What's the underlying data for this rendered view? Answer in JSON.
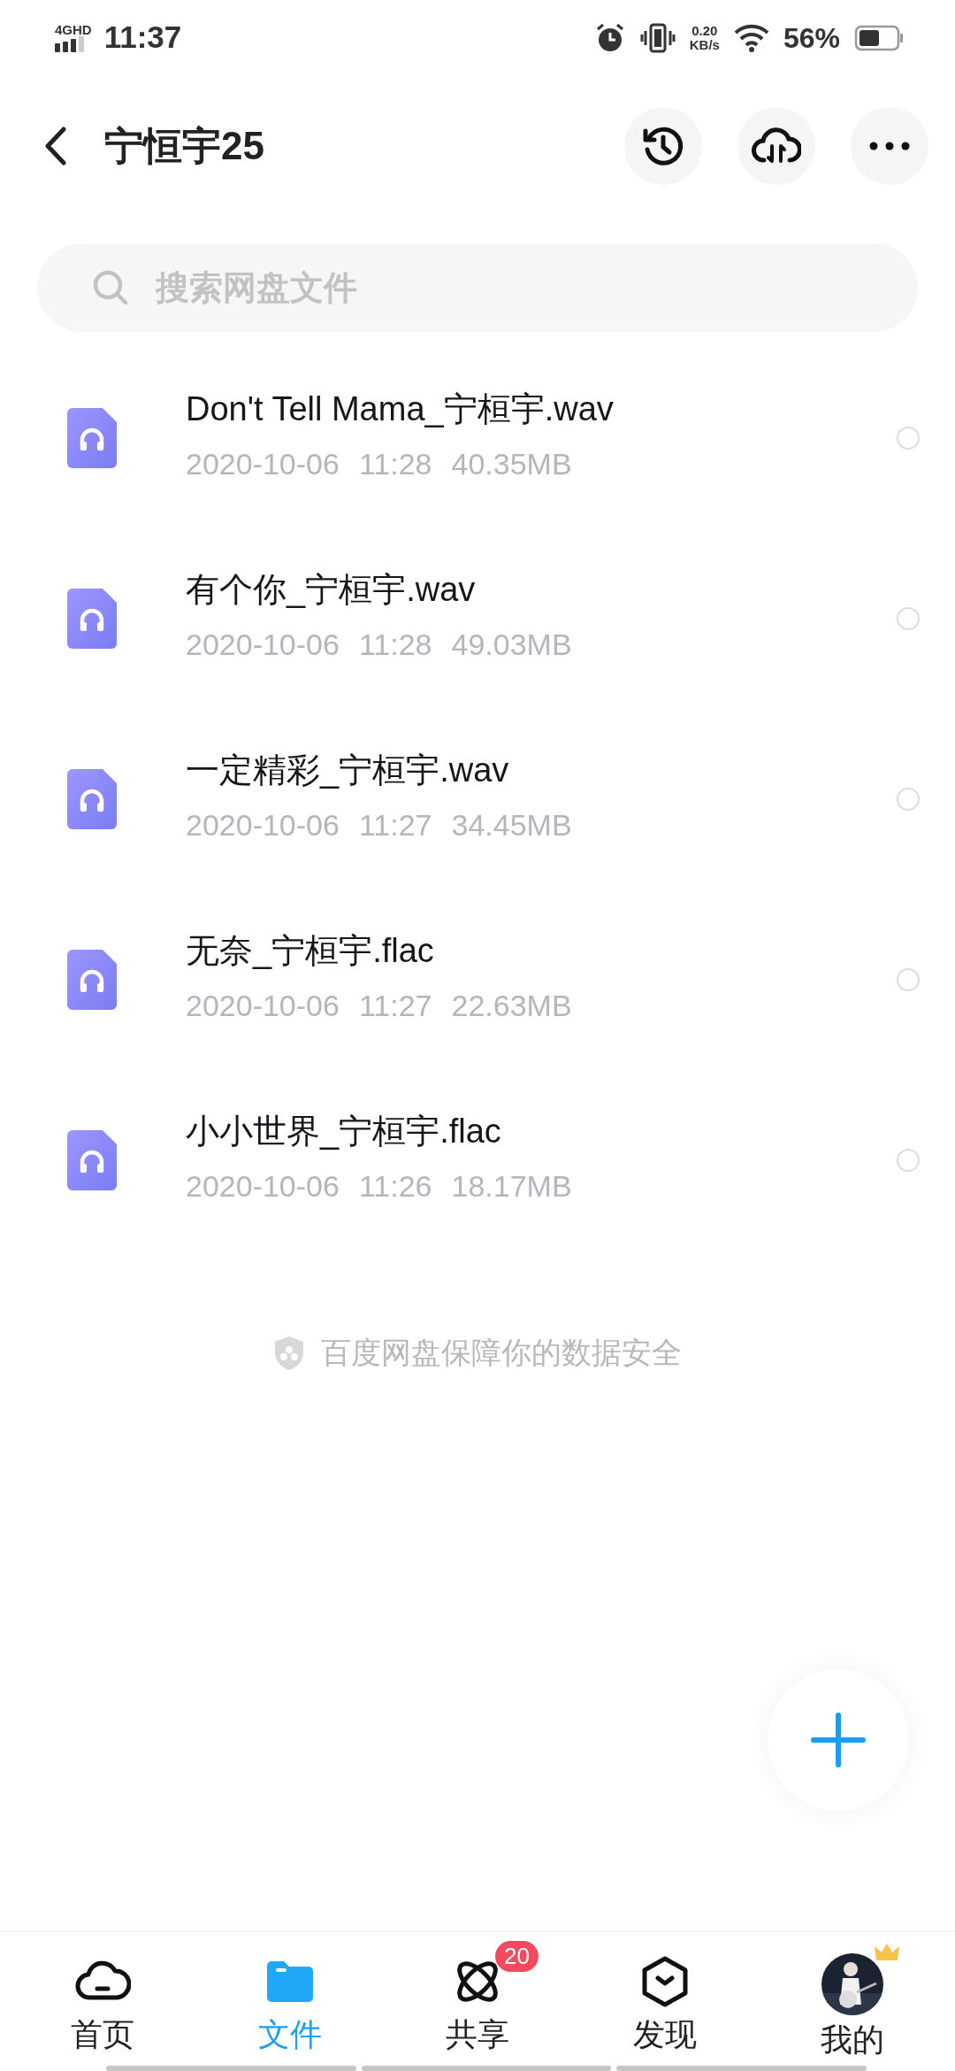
{
  "status_bar": {
    "network": "4G",
    "network_hd": "HD",
    "time": "11:37",
    "speed": "0.20",
    "speed_unit": "KB/s",
    "battery": "56%"
  },
  "header": {
    "title": "宁恒宇25"
  },
  "search": {
    "placeholder": "搜索网盘文件"
  },
  "files": [
    {
      "name": "Don't Tell Mama_宁桓宇.wav",
      "date": "2020-10-06",
      "time": "11:28",
      "size": "40.35MB",
      "selected": false
    },
    {
      "name": "有个你_宁桓宇.wav",
      "date": "2020-10-06",
      "time": "11:28",
      "size": "49.03MB",
      "selected": false
    },
    {
      "name": "一定精彩_宁桓宇.wav",
      "date": "2020-10-06",
      "time": "11:27",
      "size": "34.45MB",
      "selected": false
    },
    {
      "name": "无奈_宁桓宇.flac",
      "date": "2020-10-06",
      "time": "11:27",
      "size": "22.63MB",
      "selected": false
    },
    {
      "name": "小小世界_宁桓宇.flac",
      "date": "2020-10-06",
      "time": "11:26",
      "size": "18.17MB",
      "selected": false
    }
  ],
  "footer_note": "百度网盘保障你的数据安全",
  "tabs": [
    {
      "kind": "home",
      "label": "首页",
      "selected": false
    },
    {
      "kind": "files",
      "label": "文件",
      "selected": true
    },
    {
      "kind": "share",
      "label": "共享",
      "selected": false,
      "badge": "20"
    },
    {
      "kind": "discover",
      "label": "发现",
      "selected": false
    },
    {
      "kind": "me",
      "label": "我的",
      "selected": false
    }
  ]
}
